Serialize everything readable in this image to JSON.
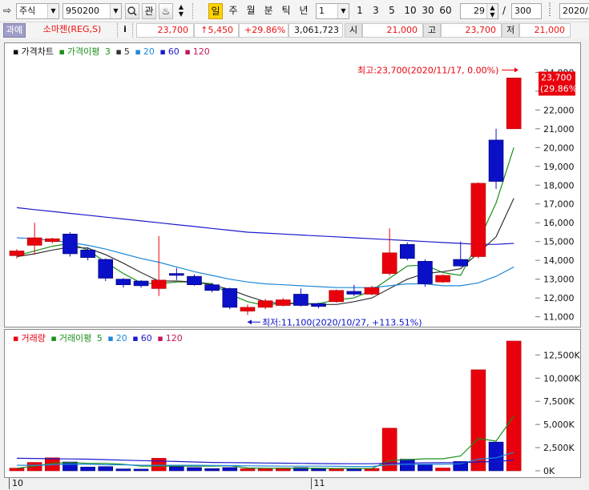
{
  "toolbar": {
    "market_label": "주식",
    "code_value": "950200",
    "gwan_label": "관",
    "periods": [
      "일",
      "주",
      "월",
      "분",
      "틱",
      "년"
    ],
    "active_period": "일",
    "interval_value": "1",
    "quick_intervals": [
      "1",
      "3",
      "5",
      "10",
      "30",
      "60"
    ],
    "count_value": "29",
    "slash": "/",
    "total_value": "300",
    "date_value": "2020/"
  },
  "quote": {
    "tag": "과예",
    "name": "소마젠(REG,S)",
    "info_label": "i",
    "price": "23,700",
    "change": "↑5,450",
    "change_pct": "+29.86%",
    "volume": "3,061,723",
    "open_label": "시",
    "open": "21,000",
    "high_label": "고",
    "high": "23,700",
    "low_label": "저",
    "low": "21,000"
  },
  "price_chart": {
    "legend_title": "가격차트",
    "legend_ma_label": "가격이평",
    "legend_periods": [
      {
        "label": "3",
        "color": "#1a8f1a"
      },
      {
        "label": "5",
        "color": "#333333"
      },
      {
        "label": "20",
        "color": "#1e88d8"
      },
      {
        "label": "60",
        "color": "#1a1acc"
      },
      {
        "label": "120",
        "color": "#c2185b"
      }
    ],
    "high_note": "최고:23,700(2020/11/17, 0.00%)",
    "low_note": "최저:11,100(2020/10/27, +113.51%)",
    "last_price": "23,700",
    "last_pct": "(29.86%)",
    "yticks": [
      "24,000",
      "23,000",
      "22,000",
      "21,000",
      "20,000",
      "19,000",
      "18,000",
      "17,000",
      "16,000",
      "15,000",
      "14,000",
      "13,000",
      "12,000",
      "11,000"
    ]
  },
  "volume_chart": {
    "legend_title": "거래량",
    "legend_ma_label": "거래이평",
    "legend_periods": [
      {
        "label": "5",
        "color": "#1a8f1a"
      },
      {
        "label": "20",
        "color": "#1e88d8"
      },
      {
        "label": "60",
        "color": "#1a1acc"
      },
      {
        "label": "120",
        "color": "#c2185b"
      }
    ],
    "yticks": [
      "12,500K",
      "10,000K",
      "7,500K",
      "5,000K",
      "2,500K",
      "0K"
    ]
  },
  "xaxis": {
    "labels": [
      {
        "text": "10",
        "index": 0
      },
      {
        "text": "11",
        "index": 17
      }
    ]
  },
  "colors": {
    "up": "#e8000c",
    "down": "#0a10c8",
    "ma3": "#1a8f1a",
    "ma5": "#333333",
    "ma20": "#1e88d8",
    "ma60": "#1a1acc"
  },
  "chart_data": {
    "type": "candlestick",
    "price_ylim": [
      10600,
      24400
    ],
    "volume_ylim": [
      0,
      14000
    ],
    "candles": [
      {
        "o": 14250,
        "c": 14500,
        "h": 14600,
        "l": 14100,
        "v": 280
      },
      {
        "o": 14800,
        "c": 15200,
        "h": 16000,
        "l": 14300,
        "v": 900
      },
      {
        "o": 15000,
        "c": 15150,
        "h": 15200,
        "l": 14900,
        "v": 1400
      },
      {
        "o": 15400,
        "c": 14350,
        "h": 15500,
        "l": 14200,
        "v": 950
      },
      {
        "o": 14550,
        "c": 14150,
        "h": 14700,
        "l": 14000,
        "v": 400
      },
      {
        "o": 14050,
        "c": 13050,
        "h": 14100,
        "l": 12900,
        "v": 450
      },
      {
        "o": 13000,
        "c": 12700,
        "h": 13050,
        "l": 12550,
        "v": 200
      },
      {
        "o": 12900,
        "c": 12650,
        "h": 12950,
        "l": 12550,
        "v": 180
      },
      {
        "o": 12500,
        "c": 12950,
        "h": 15300,
        "l": 12100,
        "v": 1350
      },
      {
        "o": 13300,
        "c": 13200,
        "h": 13600,
        "l": 12950,
        "v": 450
      },
      {
        "o": 13150,
        "c": 12700,
        "h": 13250,
        "l": 12650,
        "v": 350
      },
      {
        "o": 12700,
        "c": 12400,
        "h": 12800,
        "l": 12300,
        "v": 230
      },
      {
        "o": 12500,
        "c": 11500,
        "h": 12550,
        "l": 11400,
        "v": 350
      },
      {
        "o": 11300,
        "c": 11500,
        "h": 11650,
        "l": 11100,
        "v": 220
      },
      {
        "o": 11500,
        "c": 11850,
        "h": 11950,
        "l": 11400,
        "v": 250
      },
      {
        "o": 11600,
        "c": 11900,
        "h": 12000,
        "l": 11550,
        "v": 300
      },
      {
        "o": 12200,
        "c": 11600,
        "h": 12500,
        "l": 11550,
        "v": 350
      },
      {
        "o": 11700,
        "c": 11550,
        "h": 11750,
        "l": 11450,
        "v": 200
      },
      {
        "o": 11800,
        "c": 12400,
        "h": 12450,
        "l": 11750,
        "v": 250
      },
      {
        "o": 12350,
        "c": 12200,
        "h": 12700,
        "l": 12100,
        "v": 250
      },
      {
        "o": 12200,
        "c": 12550,
        "h": 12650,
        "l": 12150,
        "v": 250
      },
      {
        "o": 13300,
        "c": 14400,
        "h": 15700,
        "l": 13200,
        "v": 4600
      },
      {
        "o": 14850,
        "c": 14100,
        "h": 14950,
        "l": 14000,
        "v": 1250
      },
      {
        "o": 13950,
        "c": 12750,
        "h": 14050,
        "l": 12600,
        "v": 700
      },
      {
        "o": 12850,
        "c": 13200,
        "h": 13250,
        "l": 12800,
        "v": 300
      },
      {
        "o": 14050,
        "c": 13700,
        "h": 15000,
        "l": 13650,
        "v": 1000
      },
      {
        "o": 14200,
        "c": 18100,
        "h": 18150,
        "l": 14100,
        "v": 10900
      },
      {
        "o": 20400,
        "c": 18200,
        "h": 21000,
        "l": 17800,
        "v": 3100
      },
      {
        "o": 21000,
        "c": 23700,
        "h": 23700,
        "l": 21000,
        "v": 14000
      }
    ],
    "ma": [
      {
        "name": "3",
        "color": "#1a8f1a",
        "values": [
          14250,
          14500,
          14750,
          14900,
          14550,
          13900,
          13300,
          12800,
          12750,
          12850,
          12850,
          12750,
          12200,
          11800,
          11600,
          11750,
          11700,
          11700,
          11900,
          12000,
          12400,
          13050,
          13700,
          13750,
          13350,
          13200,
          15000,
          17050,
          20000
        ]
      },
      {
        "name": "5",
        "color": "#333333",
        "values": [
          14200,
          14350,
          14550,
          14700,
          14650,
          14300,
          13850,
          13350,
          12900,
          12900,
          12850,
          12700,
          12450,
          12100,
          11800,
          11700,
          11700,
          11650,
          11650,
          11800,
          12000,
          12500,
          13000,
          13300,
          13400,
          13550,
          14400,
          15250,
          17300
        ]
      },
      {
        "name": "20",
        "color": "#1e88d8",
        "values": [
          15200,
          15150,
          15050,
          14950,
          14800,
          14600,
          14350,
          14100,
          13900,
          13650,
          13400,
          13200,
          13000,
          12850,
          12750,
          12700,
          12650,
          12600,
          12550,
          12550,
          12550,
          12650,
          12750,
          12750,
          12650,
          12650,
          12800,
          13150,
          13650
        ]
      },
      {
        "name": "60",
        "color": "#1a1acc",
        "values": [
          16800,
          16700,
          16600,
          16500,
          16400,
          16300,
          16200,
          16100,
          16000,
          15900,
          15800,
          15700,
          15600,
          15500,
          15450,
          15400,
          15350,
          15300,
          15250,
          15200,
          15150,
          15100,
          15050,
          15000,
          14950,
          14900,
          14850,
          14850,
          14900
        ]
      }
    ],
    "volume_ma": [
      {
        "name": "5",
        "color": "#1a8f1a",
        "values": [
          280,
          500,
          800,
          900,
          800,
          800,
          700,
          500,
          500,
          500,
          500,
          500,
          550,
          300,
          280,
          270,
          270,
          270,
          250,
          250,
          250,
          1100,
          1200,
          1300,
          1300,
          1600,
          3500,
          3200,
          5900
        ]
      },
      {
        "name": "20",
        "color": "#1e88d8",
        "values": [
          600,
          600,
          650,
          700,
          700,
          650,
          650,
          600,
          600,
          600,
          600,
          580,
          560,
          540,
          520,
          500,
          500,
          500,
          480,
          470,
          470,
          650,
          700,
          700,
          700,
          750,
          1250,
          1400,
          2000
        ]
      },
      {
        "name": "60",
        "color": "#1a1acc",
        "values": [
          1350,
          1330,
          1300,
          1280,
          1250,
          1200,
          1150,
          1100,
          1050,
          1000,
          950,
          900,
          880,
          860,
          840,
          820,
          800,
          780,
          770,
          760,
          760,
          820,
          840,
          860,
          870,
          880,
          950,
          1000,
          1150
        ]
      }
    ]
  }
}
